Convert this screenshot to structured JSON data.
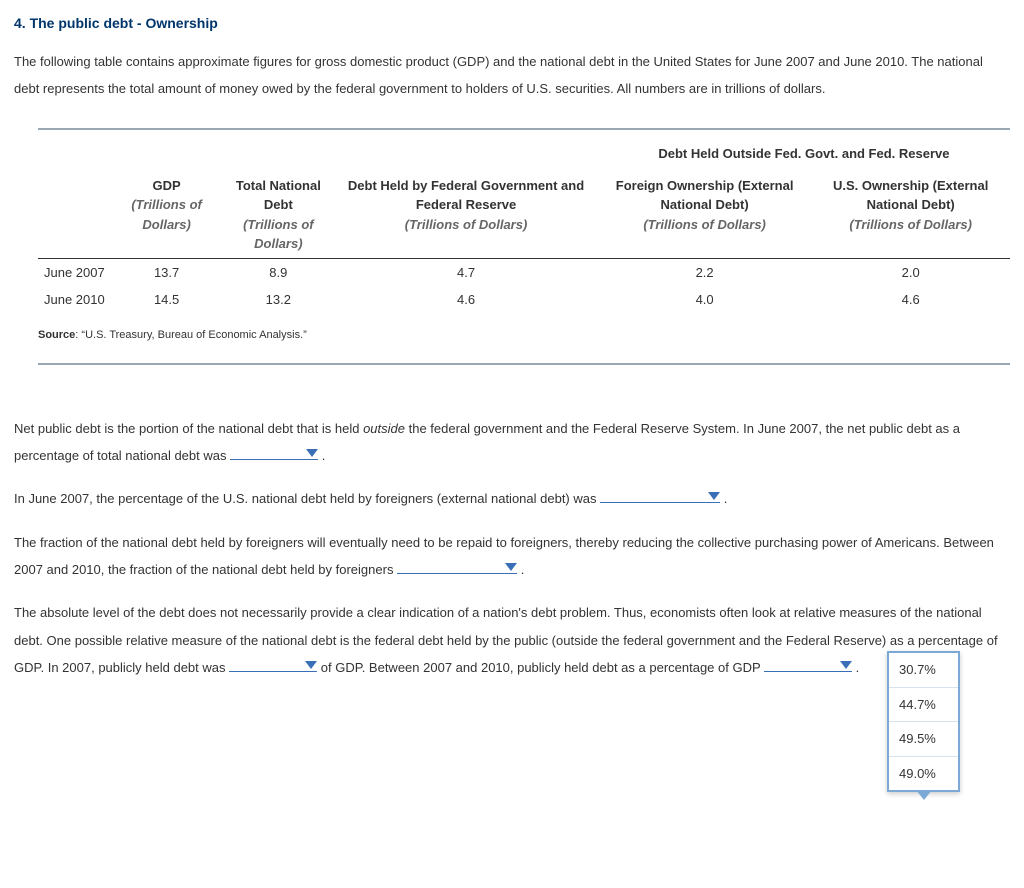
{
  "title": "4. The public debt - Ownership",
  "intro": "The following table contains approximate figures for gross domestic product (GDP) and the national debt in the United States for June 2007 and June 2010. The national debt represents the total amount of money owed by the federal government to holders of U.S. securities. All numbers are in trillions of dollars.",
  "table": {
    "group_header": "Debt Held Outside Fed. Govt. and Fed. Reserve",
    "columns": {
      "gdp": {
        "label": "GDP",
        "sub": "(Trillions of Dollars)"
      },
      "total": {
        "label": "Total National Debt",
        "sub": "(Trillions of Dollars)"
      },
      "held_fed": {
        "label": "Debt Held by Federal Government and Federal Reserve",
        "sub": "(Trillions of Dollars)"
      },
      "foreign": {
        "label": "Foreign Ownership (External National Debt)",
        "sub": "(Trillions of Dollars)"
      },
      "us": {
        "label": "U.S. Ownership (External National Debt)",
        "sub": "(Trillions of Dollars)"
      }
    },
    "rows": [
      {
        "label": "June 2007",
        "gdp": "13.7",
        "total": "8.9",
        "held_fed": "4.7",
        "foreign": "2.2",
        "us": "2.0"
      },
      {
        "label": "June 2010",
        "gdp": "14.5",
        "total": "13.2",
        "held_fed": "4.6",
        "foreign": "4.0",
        "us": "4.6"
      }
    ],
    "source_label": "Source",
    "source_value": ": “U.S. Treasury, Bureau of Economic Analysis.”"
  },
  "paragraphs": {
    "p1a": "Net public debt is the portion of the national debt that is held ",
    "p1_em": "outside",
    "p1b": " the federal government and the Federal Reserve System. In June 2007, the net public debt as a percentage of total national debt was ",
    "p1c": " .",
    "p2a": "In June 2007, the percentage of the U.S. national debt held by foreigners (external national debt) was ",
    "p2b": " .",
    "p3a": "The fraction of the national debt held by foreigners will eventually need to be repaid to foreigners, thereby reducing the collective purchasing power of Americans. Between 2007 and 2010, the fraction of the national debt held by foreigners ",
    "p3b": " .",
    "p4a": "The absolute level of the debt does not necessarily provide a clear indication of a nation's debt problem. Thus, economists often look at relative measures of the national debt. One possible relative measure of the national debt is the federal debt held by the public (outside the federal government and the Federal Reserve) as a percentage of GDP. In 2007, publicly held debt was ",
    "p4b": " of GDP. Between 2007 and 2010, publicly held debt as a percentage of GDP ",
    "p4c": " ."
  },
  "dropdown_options": [
    "30.7%",
    "44.7%",
    "49.5%",
    "49.0%"
  ]
}
